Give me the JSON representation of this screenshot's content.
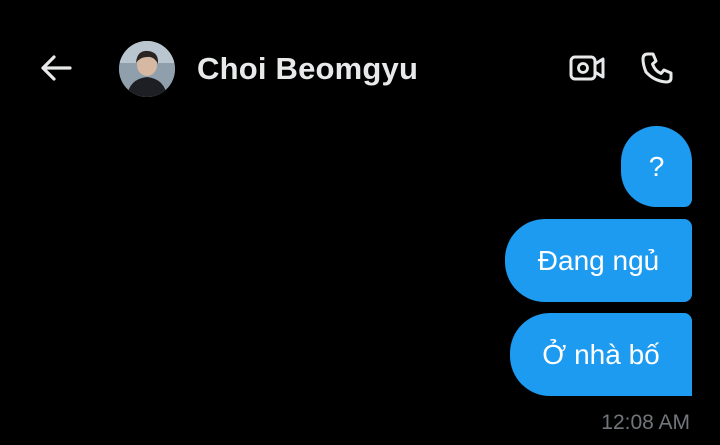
{
  "header": {
    "contact_name": "Choi Beomgyu",
    "icons": {
      "back": "arrow-left-icon",
      "video": "video-camera-icon",
      "call": "phone-icon"
    }
  },
  "messages": [
    {
      "text": "?",
      "sender": "me"
    },
    {
      "text": "Đang ngủ",
      "sender": "me"
    },
    {
      "text": "Ở nhà bố",
      "sender": "me"
    }
  ],
  "timestamp": "12:08 AM",
  "colors": {
    "background": "#000000",
    "bubble": "#1d9bf0",
    "bubble_text": "#ffffff",
    "name_text": "#e7e9ea",
    "timestamp_text": "#71767b"
  }
}
